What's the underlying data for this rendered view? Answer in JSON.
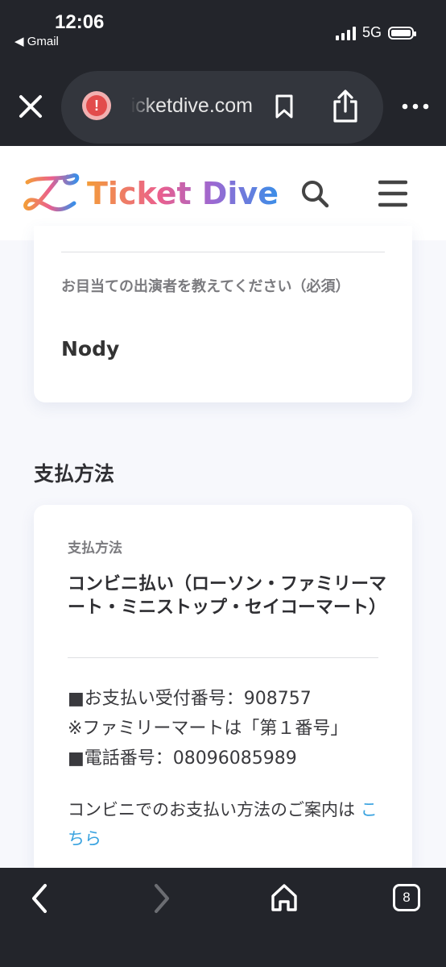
{
  "status_bar": {
    "time": "12:06",
    "back_app": "◀ Gmail",
    "network": "5G"
  },
  "browser": {
    "url": "ticketdive.com",
    "tab_count": "8"
  },
  "site": {
    "logo_text": "Ticket Dive"
  },
  "performer_card": {
    "question_label": "お目当ての出演者を教えてください（必須）",
    "answer": "Nody"
  },
  "payment_section": {
    "title": "支払方法",
    "method_label": "支払方法",
    "method_value": "コンビニ払い（ローソン・ファミリーマート・ミニストップ・セイコーマート）",
    "receipt_number_line": "■お支払い受付番号：908757",
    "familymart_note": "※ファミリーマートは「第１番号」",
    "phone_line": "■電話番号：08096085989",
    "guide_text": "コンビニでのお支払い方法のご案内は",
    "guide_link": "こちら"
  },
  "colors": {
    "chrome_bg": "#23252b",
    "link": "#3aa3e0",
    "warning": "#e24c4c"
  }
}
